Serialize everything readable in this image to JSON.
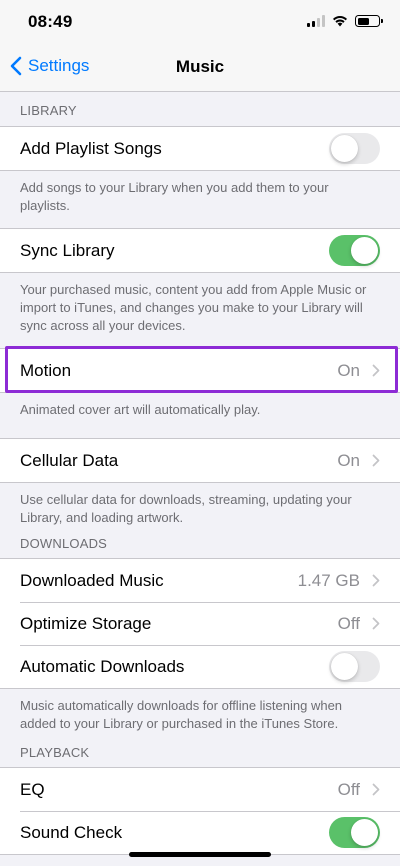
{
  "status_bar": {
    "time": "08:49"
  },
  "nav": {
    "back_label": "Settings",
    "title": "Music"
  },
  "library": {
    "header": "LIBRARY",
    "add_playlist_songs": {
      "label": "Add Playlist Songs",
      "toggle": "off"
    },
    "add_playlist_footer": "Add songs to your Library when you add them to your playlists.",
    "sync_library": {
      "label": "Sync Library",
      "toggle": "on"
    },
    "sync_library_footer": "Your purchased music, content you add from Apple Music or import to iTunes, and changes you make to your Library will sync across all your devices.",
    "motion": {
      "label": "Motion",
      "value": "On"
    },
    "motion_footer": "Animated cover art will automatically play.",
    "cellular_data": {
      "label": "Cellular Data",
      "value": "On"
    },
    "cellular_footer": "Use cellular data for downloads, streaming, updating your Library, and loading artwork."
  },
  "downloads": {
    "header": "DOWNLOADS",
    "downloaded_music": {
      "label": "Downloaded Music",
      "value": "1.47 GB"
    },
    "optimize_storage": {
      "label": "Optimize Storage",
      "value": "Off"
    },
    "automatic_downloads": {
      "label": "Automatic Downloads",
      "toggle": "off"
    },
    "footer": "Music automatically downloads for offline listening when added to your Library or purchased in the iTunes Store."
  },
  "playback": {
    "header": "PLAYBACK",
    "eq": {
      "label": "EQ",
      "value": "Off"
    },
    "sound_check": {
      "label": "Sound Check",
      "toggle": "on"
    }
  },
  "colors": {
    "accent": "#007aff",
    "toggle_on": "#5ac169",
    "highlight": "#8d2bd5",
    "background": "#f2f2f7"
  }
}
